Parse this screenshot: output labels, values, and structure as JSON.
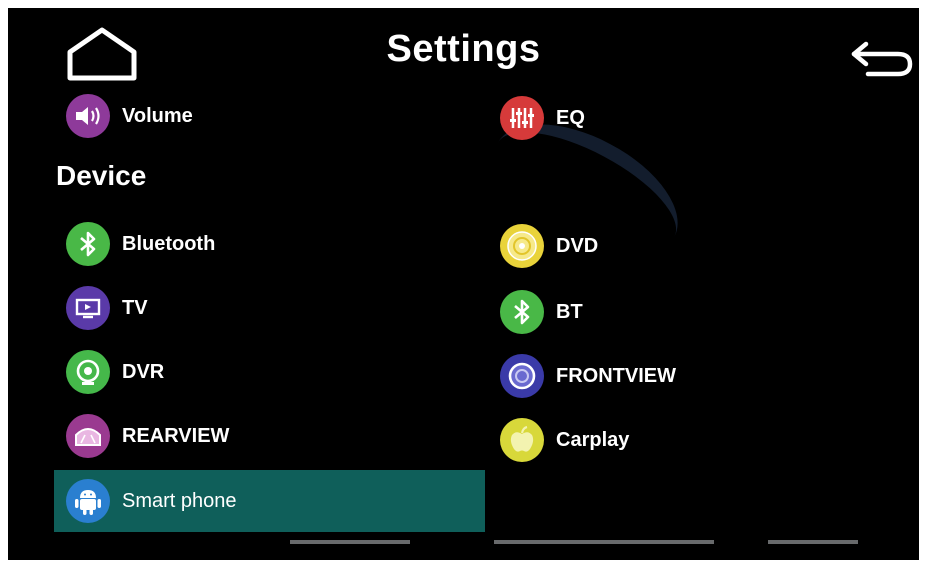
{
  "header": {
    "title": "Settings",
    "home_icon": "home-icon",
    "back_icon": "back-arrow-icon"
  },
  "sections": {
    "device_heading": "Device"
  },
  "items": {
    "volume": {
      "label": "Volume",
      "icon": "speaker-icon",
      "color": "#8e3a9a"
    },
    "eq": {
      "label": "EQ",
      "icon": "equalizer-icon",
      "color": "#d63a3a"
    },
    "bluetooth": {
      "label": "Bluetooth",
      "icon": "bluetooth-icon",
      "color": "#49b847"
    },
    "dvd": {
      "label": "DVD",
      "icon": "disc-icon",
      "color": "#e9d33a"
    },
    "tv": {
      "label": "TV",
      "icon": "tv-icon",
      "color": "#5a3aa8"
    },
    "bt": {
      "label": "BT",
      "icon": "bluetooth-icon",
      "color": "#49b847"
    },
    "dvr": {
      "label": "DVR",
      "icon": "camera-icon",
      "color": "#45b84a"
    },
    "frontview": {
      "label": "FRONTVIEW",
      "icon": "frontview-camera-icon",
      "color": "#3a3aa8"
    },
    "rearview": {
      "label": "REARVIEW",
      "icon": "rearview-camera-icon",
      "color": "#9a3a90"
    },
    "carplay": {
      "label": "Carplay",
      "icon": "apple-icon",
      "color": "#d8d83a"
    },
    "smart_phone": {
      "label": "Smart phone",
      "icon": "android-icon",
      "color": "#2a7fd0",
      "selected": true
    }
  },
  "colors": {
    "background": "#000000",
    "selected_row": "#0f5f5a",
    "text": "#ffffff"
  }
}
